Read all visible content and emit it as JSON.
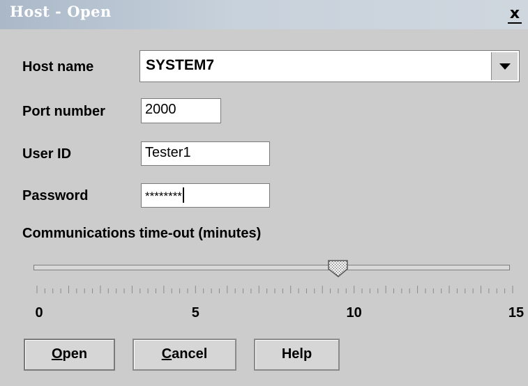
{
  "window": {
    "title": "Host - Open",
    "close_symbol": "x",
    "close_icon": "close-icon"
  },
  "form": {
    "host_name_label": "Host name",
    "host_name_value": "SYSTEM7",
    "port_label": "Port number",
    "port_value": "2000",
    "user_label": "User ID",
    "user_value": "Tester1",
    "password_label": "Password",
    "password_value": "********",
    "timeout_label": "Communications time-out (minutes)"
  },
  "slider": {
    "min": 0,
    "max": 15,
    "value": 9.5,
    "tick_labels": [
      "0",
      "5",
      "10",
      "15"
    ],
    "thumb_icon": "slider-thumb-icon"
  },
  "buttons": {
    "open_mnemonic": "O",
    "open_rest": "pen",
    "cancel_mnemonic": "C",
    "cancel_rest": "ancel",
    "help_label": "Help"
  },
  "colors": {
    "background": "#cccccc",
    "title_text": "#ffffff"
  }
}
